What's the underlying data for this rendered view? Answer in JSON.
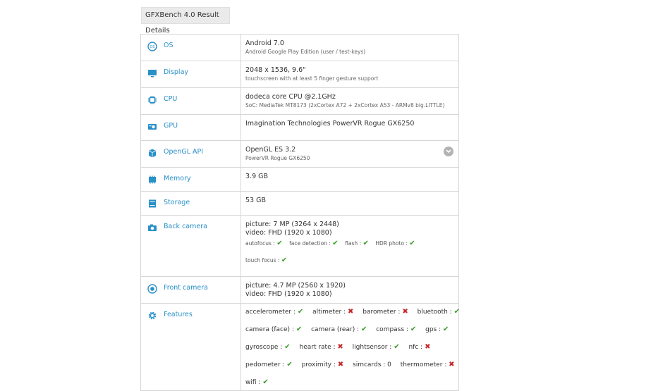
{
  "page_title": "GFXBench 4.0 Result Details",
  "rows": {
    "os": {
      "label": "OS",
      "main": "Android 7.0",
      "sub": "Android Google Play Edition (user / test-keys)"
    },
    "display": {
      "label": "Display",
      "main": "2048 x 1536, 9.6\"",
      "sub": "touchscreen with at least 5 finger gesture support"
    },
    "cpu": {
      "label": "CPU",
      "main": "dodeca core CPU @2.1GHz",
      "sub": "SoC: MediaTek MT8173 (2xCortex A72 + 2xCortex A53 - ARMv8 big.LITTLE)"
    },
    "gpu": {
      "label": "GPU",
      "main": "Imagination Technologies PowerVR Rogue GX6250"
    },
    "opengl": {
      "label": "OpenGL API",
      "main": "OpenGL ES 3.2",
      "sub": "PowerVR Rogue GX6250"
    },
    "memory": {
      "label": "Memory",
      "main": "3.9 GB"
    },
    "storage": {
      "label": "Storage",
      "main": "53 GB"
    },
    "back_camera": {
      "label": "Back camera",
      "picture": "picture: 7 MP (3264 x 2448)",
      "video": "video: FHD (1920 x 1080)",
      "features": [
        {
          "name": "autofocus :",
          "status": "yes"
        },
        {
          "name": "face detection :",
          "status": "yes"
        },
        {
          "name": "flash :",
          "status": "yes"
        },
        {
          "name": "HDR photo :",
          "status": "yes"
        }
      ],
      "touch_focus": {
        "name": "touch focus :",
        "status": "yes"
      }
    },
    "front_camera": {
      "label": "Front camera",
      "picture": "picture: 4.7 MP (2560 x 1920)",
      "video": "video: FHD (1920 x 1080)"
    },
    "features": {
      "label": "Features",
      "lines": [
        [
          {
            "name": "accelerometer :",
            "status": "yes"
          },
          {
            "name": "altimeter :",
            "status": "no"
          },
          {
            "name": "barometer :",
            "status": "no"
          },
          {
            "name": "bluetooth :",
            "status": "yes"
          }
        ],
        [
          {
            "name": "camera (face) :",
            "status": "yes"
          },
          {
            "name": "camera (rear) :",
            "status": "yes"
          },
          {
            "name": "compass :",
            "status": "yes"
          },
          {
            "name": "gps :",
            "status": "yes"
          }
        ],
        [
          {
            "name": "gyroscope :",
            "status": "yes"
          },
          {
            "name": "heart rate :",
            "status": "no"
          },
          {
            "name": "lightsensor :",
            "status": "yes"
          },
          {
            "name": "nfc :",
            "status": "no"
          }
        ],
        [
          {
            "name": "pedometer :",
            "status": "yes"
          },
          {
            "name": "proximity :",
            "status": "no"
          },
          {
            "name": "simcards : 0",
            "status": ""
          },
          {
            "name": "thermometer :",
            "status": "no"
          }
        ],
        [
          {
            "name": "wifi :",
            "status": "yes"
          }
        ]
      ]
    }
  },
  "glyphs": {
    "yes": "✔",
    "no": "✖"
  },
  "colors": {
    "label": "#2a90c8",
    "check": "#3a9a2a",
    "cross": "#c62828",
    "icon": "#2a90c8"
  }
}
